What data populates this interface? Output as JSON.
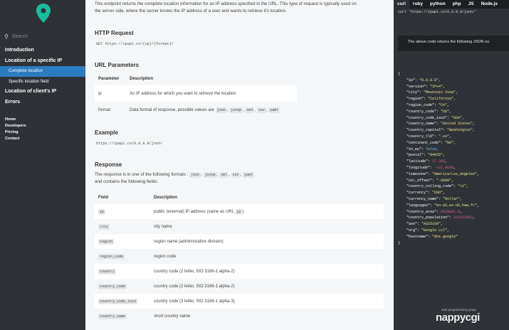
{
  "sidebar": {
    "search_placeholder": "Search",
    "nav": [
      {
        "label": "Introduction"
      },
      {
        "label": "Location of a specific IP"
      },
      {
        "label": "Complete location"
      },
      {
        "label": "Specific location field"
      },
      {
        "label": "Location of client's IP"
      },
      {
        "label": "Errors"
      }
    ],
    "links": [
      "Home",
      "Developers",
      "Pricing",
      "Contact"
    ]
  },
  "main": {
    "intro_line1": "This endpoint returns the complete location information for an IP address specified in the URL. This type of request is typically used on",
    "intro_line2": "the server side, where the server knows the IP address of a user and wants to retrieve it's location.",
    "http_request_title": "HTTP Request",
    "http_request": "GET https://ipapi.co/{ip}/{format}/",
    "url_params_title": "URL Parameters",
    "params_headers": [
      "Parameter",
      "Description"
    ],
    "params": [
      {
        "name": "ip",
        "desc": "An IP address for which you want to retrieve the location"
      },
      {
        "name": "format",
        "desc": "Data format of response, possible values are",
        "chips": [
          "json",
          "jsonp",
          "xml",
          "csv",
          "yaml"
        ]
      }
    ],
    "example_title": "Example",
    "example": "https://ipapi.co/8.8.8.8/json/",
    "response_title": "Response",
    "response_text1": "The response is in one of the following formats :",
    "response_chips": [
      "json",
      "jsonp",
      "xml",
      "csv",
      "yaml"
    ],
    "response_text2": "and contains the following fields:",
    "fields_headers": [
      "Field",
      "Description"
    ],
    "fields": [
      {
        "name": "ip",
        "desc": "public (external) IP address (same as URL",
        "chip": "ip",
        "after": ")"
      },
      {
        "name": "city",
        "desc": "city name"
      },
      {
        "name": "region",
        "desc": "region name (administrative division)"
      },
      {
        "name": "region_code",
        "desc": "region code"
      },
      {
        "name": "country",
        "desc": "country code (2 letter, ISO 3166-1 alpha-2)"
      },
      {
        "name": "country_code",
        "desc": "country code (2 letter, ISO 3166-1 alpha-2)"
      },
      {
        "name": "country_code_iso3",
        "desc": "country code (3 letter, ISO 3166-1 alpha-3)"
      },
      {
        "name": "country_name",
        "desc": "short country name"
      }
    ]
  },
  "right": {
    "tabs": [
      "curl",
      "ruby",
      "python",
      "php",
      "JS",
      "Node.js"
    ],
    "curl_cmd": "curl 'https://ipapi.co/8.8.8.8/json/'",
    "note": "The above code returns the following JSON ou",
    "json_lines": [
      [
        "{",
        "",
        ""
      ],
      [
        "    \"ip\": ",
        "\"8.8.8.8\"",
        "s"
      ],
      [
        "    \"version\": ",
        "\"IPv4\"",
        "s"
      ],
      [
        "    \"city\": ",
        "\"Mountain View\"",
        "s"
      ],
      [
        "    \"region\": ",
        "\"California\"",
        "s"
      ],
      [
        "    \"region_code\": ",
        "\"CA\"",
        "s"
      ],
      [
        "    \"country_code\": ",
        "\"US\"",
        "s"
      ],
      [
        "    \"country_code_iso3\": ",
        "\"USA\"",
        "s"
      ],
      [
        "    \"country_name\": ",
        "\"United States\"",
        "s"
      ],
      [
        "    \"country_capital\": ",
        "\"Washington\"",
        "s"
      ],
      [
        "    \"country_tld\": ",
        "\".us\"",
        "s"
      ],
      [
        "    \"continent_code\": ",
        "\"NA\"",
        "s"
      ],
      [
        "    \"in_eu\": ",
        "false",
        "b"
      ],
      [
        "    \"postal\": ",
        "\"94035\"",
        "s"
      ],
      [
        "    \"latitude\": ",
        "37.386",
        "n"
      ],
      [
        "    \"longitude\": ",
        "-122.0838",
        "n"
      ],
      [
        "    \"timezone\": ",
        "\"America/Los_Angeles\"",
        "s"
      ],
      [
        "    \"utc_offset\": ",
        "\"-0800\"",
        "s"
      ],
      [
        "    \"country_calling_code\": ",
        "\"+1\"",
        "s"
      ],
      [
        "    \"currency\": ",
        "\"USD\"",
        "s"
      ],
      [
        "    \"currency_name\": ",
        "\"Dollar\"",
        "s"
      ],
      [
        "    \"languages\": ",
        "\"en-US,es-US,haw,fr\"",
        "s"
      ],
      [
        "    \"country_area\": ",
        "9629091.0",
        "n"
      ],
      [
        "    \"country_population\": ",
        "310232863",
        "n"
      ],
      [
        "    \"asn\": ",
        "\"AS15169\"",
        "s"
      ],
      [
        "    \"org\": ",
        "\"Google LLC\"",
        "s"
      ],
      [
        "    \"hostname\": ",
        "\"dns.google\"",
        "s"
      ],
      [
        "}",
        "",
        ""
      ]
    ],
    "brand_small": "web programming group",
    "brand_big": "nappycgi"
  },
  "colors": {
    "accent": "#2b7bc1",
    "logo": "#1abc9c",
    "sidebar": "#2e3236",
    "right_panel": "#2f3337"
  }
}
